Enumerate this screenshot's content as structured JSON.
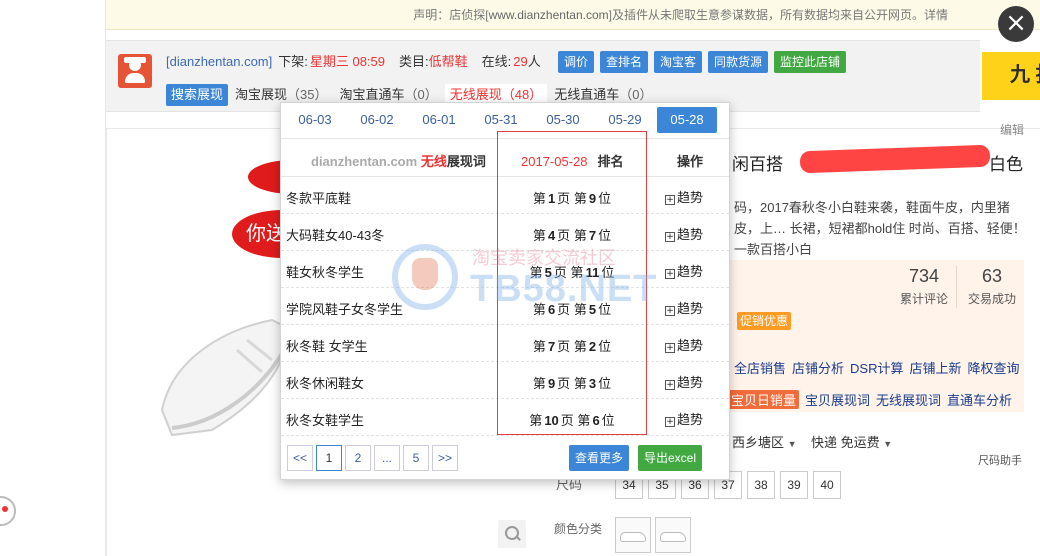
{
  "notice": {
    "prefix": "声明：店侦探[",
    "link": "www.dianzhentan.com",
    "suffix": "]及插件从未爬取生意参谋数据，所有数据均来自公开网页。",
    "detail": "详情"
  },
  "toolbar": {
    "site": "[dianzhentan.com]",
    "offshelf_label": "下架:",
    "offshelf_value": "星期三 08:59",
    "category_label": "类目:",
    "category_value": "低帮鞋",
    "online_label": "在线:",
    "online_value": "29",
    "online_unit": "人",
    "buttons": [
      "调价",
      "查排名",
      "淘宝客",
      "同款货源",
      "监控此店铺"
    ],
    "tabs": [
      {
        "label": "搜索展现",
        "count": ""
      },
      {
        "label": "淘宝展现",
        "count": "（35）"
      },
      {
        "label": "淘宝直通车",
        "count": "（0）"
      },
      {
        "label": "无线展现",
        "count": "（48）"
      },
      {
        "label": "无线直通车",
        "count": "（0）"
      }
    ]
  },
  "ad": {
    "text": "九 折"
  },
  "popup": {
    "dates": [
      "06-03",
      "06-02",
      "06-01",
      "05-31",
      "05-30",
      "05-29",
      "05-28"
    ],
    "active_date": "05-28",
    "header": {
      "site": "dianzhentan.com",
      "wifi": "无线",
      "word": "展现词",
      "date": "2017-05-28",
      "rank": "排名",
      "op": "操作"
    },
    "rows": [
      {
        "keyword": "冬款平底鞋",
        "page": "1",
        "pos": "9"
      },
      {
        "keyword": "大码鞋女40-43冬",
        "page": "4",
        "pos": "7"
      },
      {
        "keyword": "鞋女秋冬学生",
        "page": "5",
        "pos": "11"
      },
      {
        "keyword": "学院风鞋子女冬学生",
        "page": "6",
        "pos": "5"
      },
      {
        "keyword": "秋冬鞋 女学生",
        "page": "7",
        "pos": "2"
      },
      {
        "keyword": "秋冬休闲鞋女",
        "page": "9",
        "pos": "3"
      },
      {
        "keyword": "秋冬女鞋学生",
        "page": "10",
        "pos": "6"
      }
    ],
    "rank_words": {
      "di": "第",
      "ye": "页",
      "wei": "位"
    },
    "trend_label": "趋势",
    "plus": "+",
    "pager": [
      "<<",
      "1",
      "2",
      "...",
      "5",
      ">>"
    ],
    "more_button": "查看更多",
    "excel_button": "导出excel"
  },
  "product": {
    "edit": "编辑",
    "ribbon_text": "你送",
    "title": "闲百搭",
    "title_tail": "白色",
    "desc": "码，2017春秋冬小白鞋来袭，鞋面牛皮，内里猪皮，上… 长裙，短裙都hold住 时尚、百搭、轻便！一款百搭小白",
    "stats": [
      {
        "num": "734",
        "label": "累计评论"
      },
      {
        "num": "63",
        "label": "交易成功"
      }
    ],
    "promo": "促销优惠",
    "links1": [
      "全店销售",
      "店铺分析",
      "DSR计算",
      "店铺上新",
      "降权查询"
    ],
    "links2_badge": "宝贝日销量",
    "links2": [
      "宝贝展现词",
      "无线展现词",
      "直通车分析"
    ],
    "ship_from": "西乡塘区",
    "ship_type": "快递 免运费",
    "size_helper": "尺码助手",
    "size_label": "尺码",
    "sizes": [
      "34",
      "35",
      "36",
      "37",
      "38",
      "39",
      "40"
    ],
    "color_label": "颜色分类"
  },
  "watermark": {
    "line1": "淘宝卖家交流社区",
    "line2": "TB58.NET"
  },
  "colors": {
    "accent": "#3b86d6",
    "green": "#42a842",
    "red": "#e33333"
  }
}
